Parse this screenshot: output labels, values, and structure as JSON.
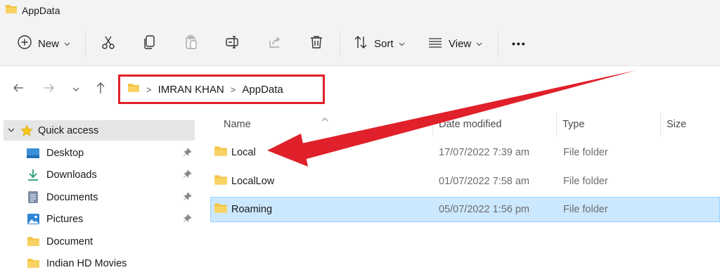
{
  "window": {
    "title": "AppData"
  },
  "toolbar": {
    "new_label": "New",
    "sort_label": "Sort",
    "view_label": "View",
    "more_label": "•••"
  },
  "address": {
    "crumbs": [
      "IMRAN KHAN",
      "AppData"
    ],
    "highlight_color": "#e0202a"
  },
  "sidebar": {
    "items": [
      {
        "label": "Quick access",
        "icon": "star-icon",
        "pinned": false
      },
      {
        "label": "Desktop",
        "icon": "desktop-icon",
        "pinned": true
      },
      {
        "label": "Downloads",
        "icon": "download-icon",
        "pinned": true
      },
      {
        "label": "Documents",
        "icon": "documents-icon",
        "pinned": true
      },
      {
        "label": "Pictures",
        "icon": "pictures-icon",
        "pinned": true
      },
      {
        "label": "Document",
        "icon": "folder-icon",
        "pinned": false
      },
      {
        "label": "Indian HD Movies",
        "icon": "folder-icon",
        "pinned": false
      }
    ]
  },
  "columns": {
    "name": "Name",
    "date": "Date modified",
    "type": "Type",
    "size": "Size"
  },
  "files": [
    {
      "name": "Local",
      "date": "17/07/2022 7:39 am",
      "type": "File folder"
    },
    {
      "name": "LocalLow",
      "date": "01/07/2022 7:58 am",
      "type": "File folder"
    },
    {
      "name": "Roaming",
      "date": "05/07/2022 1:56 pm",
      "type": "File folder"
    }
  ],
  "colors": {
    "folder": "#f4c446",
    "selection": "#cce8ff",
    "annotation": "#e0202a"
  }
}
